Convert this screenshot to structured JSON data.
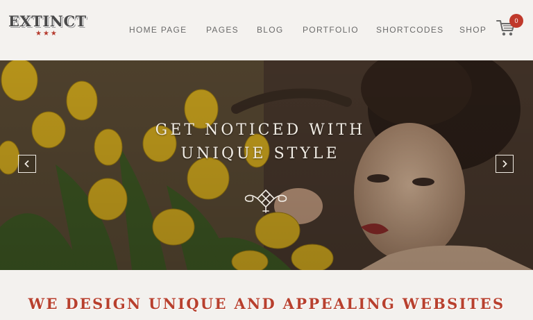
{
  "site": {
    "logo_text": "EXTINCT",
    "logo_stars": "★★★"
  },
  "nav": {
    "items": [
      {
        "label": "HOME PAGE"
      },
      {
        "label": "PAGES"
      },
      {
        "label": "BLOG"
      },
      {
        "label": "PORTFOLIO"
      },
      {
        "label": "SHORTCODES"
      },
      {
        "label": "SHOP"
      }
    ]
  },
  "cart": {
    "count": "0",
    "icon": "shopping-cart-icon"
  },
  "hero": {
    "title_line1": "GET NOTICED WITH",
    "title_line2": "UNIQUE STYLE",
    "ornament_icon": "ornament-icon",
    "prev_icon": "chevron-left-icon",
    "next_icon": "chevron-right-icon"
  },
  "tagline": "WE DESIGN UNIQUE AND APPEALING WEBSITES",
  "colors": {
    "accent": "#b8402e",
    "nav_text": "#6a6a6a",
    "logo": "#4a4a4a",
    "background": "#f3f1ee"
  }
}
